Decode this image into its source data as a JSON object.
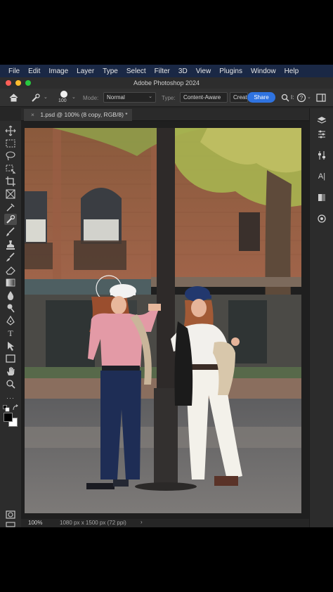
{
  "menu": [
    "File",
    "Edit",
    "Image",
    "Layer",
    "Type",
    "Select",
    "Filter",
    "3D",
    "View",
    "Plugins",
    "Window",
    "Help"
  ],
  "window": {
    "title": "Adobe Photoshop 2024",
    "traffic_colors": [
      "#ff5f57",
      "#febc2e",
      "#28c840"
    ]
  },
  "options": {
    "brush_size": "100",
    "mode_label": "Mode:",
    "mode_value": "Normal",
    "type_label": "Type:",
    "type_value": "Content-Aware",
    "create_value": "Creat",
    "share_label": "Share",
    "extra_glyph": "I:",
    "accent": "#2f73e0"
  },
  "document": {
    "tab_title": "1.psd @ 100% (8 copy, RGB/8) *",
    "close_glyph": "×"
  },
  "status": {
    "zoom": "100%",
    "info": "1080 px x 1500 px (72 ppi)",
    "arrow": "›"
  },
  "tools": [
    "move-icon",
    "marquee-icon",
    "lasso-icon",
    "object-select-icon",
    "crop-icon",
    "frame-icon",
    "eyedropper-icon",
    "spot-healing-brush-icon",
    "brush-icon",
    "clone-stamp-icon",
    "history-brush-icon",
    "eraser-icon",
    "gradient-icon",
    "blur-icon",
    "dodge-icon",
    "pen-icon",
    "type-icon",
    "path-select-icon",
    "rectangle-icon",
    "hand-icon",
    "zoom-icon",
    "more-tools-icon",
    "default-colors-icon",
    "swap-colors-icon",
    "color-swatches-icon",
    "quick-mask-icon",
    "screen-mode-icon"
  ],
  "panels": [
    "layers-panel-icon",
    "adjustments-panel-icon",
    "properties-panel-icon",
    "character-panel-icon",
    "channels-panel-icon",
    "libraries-panel-icon"
  ]
}
